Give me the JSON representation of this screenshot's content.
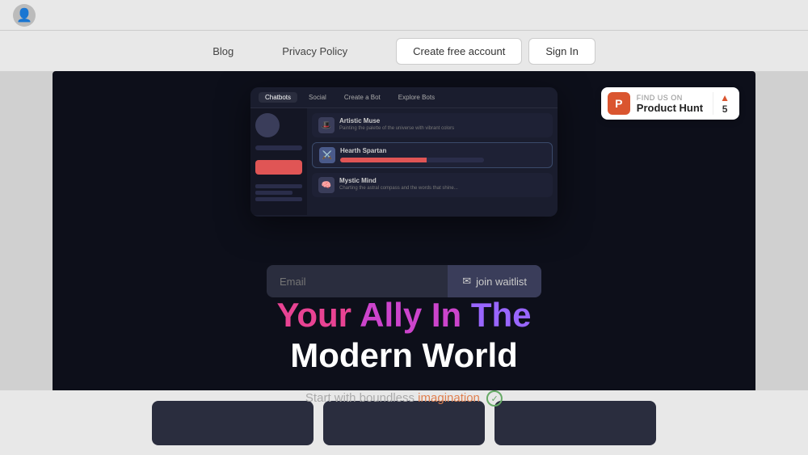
{
  "os_bar": {
    "avatar_icon": "👤"
  },
  "navbar": {
    "blog_label": "Blog",
    "privacy_label": "Privacy Policy",
    "create_account_label": "Create free account",
    "sign_in_label": "Sign In"
  },
  "product_hunt": {
    "find_text": "FIND US ON",
    "name": "Product Hunt",
    "score": "5",
    "arrow": "▲"
  },
  "app_preview": {
    "tabs": [
      "Chatbots",
      "Social",
      "Create a Bot",
      "Explore Bots"
    ],
    "bots": [
      {
        "name": "Artistic Muse",
        "desc": "Painting the palette of the universe with vibrant colors"
      },
      {
        "name": "Hearth Spartan",
        "desc": ""
      },
      {
        "name": "Mystic Mind",
        "desc": "Charting the astral compass and the words that shine..."
      }
    ]
  },
  "cta": {
    "email_placeholder": "Email",
    "join_label": "join waitlist"
  },
  "hero": {
    "line1_word1": "Your",
    "line1_word2": "Ally",
    "line1_word3": "In",
    "line1_word4": "The",
    "line2": "Modern World",
    "subtitle_prefix": "Start with boundless",
    "subtitle_highlight": "imagination"
  },
  "bottom_cards": [
    {
      "id": "card1"
    },
    {
      "id": "card2"
    },
    {
      "id": "card3"
    }
  ]
}
